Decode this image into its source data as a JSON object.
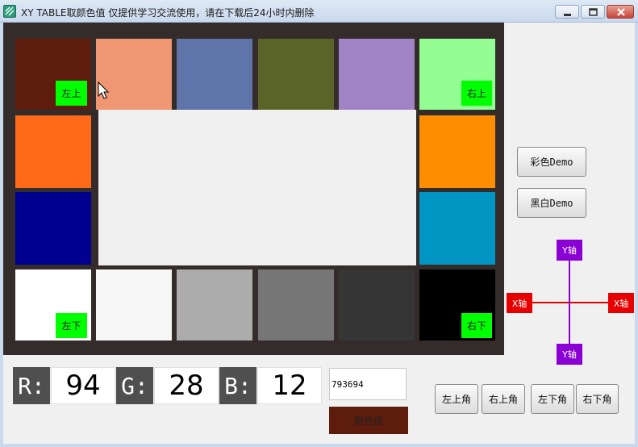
{
  "window": {
    "title": "XY TABLE取颜色值  仅提供学习交流使用，请在下载后24小时内删除",
    "icon": "app-icon",
    "controls": [
      "minimize-icon",
      "maximize-icon",
      "close-icon"
    ]
  },
  "board": {
    "background": "#332c2a",
    "swatches": [
      {
        "id": "r1c1",
        "color": "#5e1c0c"
      },
      {
        "id": "r1c2",
        "color": "#ef9673"
      },
      {
        "id": "r1c3",
        "color": "#5f74a9"
      },
      {
        "id": "r1c4",
        "color": "#5b6428"
      },
      {
        "id": "r1c5",
        "color": "#a083c4"
      },
      {
        "id": "r1c6",
        "color": "#93fd93"
      },
      {
        "id": "r2c1",
        "color": "#ff6a18"
      },
      {
        "id": "r2c6",
        "color": "#ff8d00"
      },
      {
        "id": "r3c1",
        "color": "#00008f"
      },
      {
        "id": "r3c6",
        "color": "#0095c2"
      },
      {
        "id": "r4c1",
        "color": "#ffffff"
      },
      {
        "id": "r4c2",
        "color": "#f7f7f7"
      },
      {
        "id": "r4c3",
        "color": "#acacac"
      },
      {
        "id": "r4c4",
        "color": "#767676"
      },
      {
        "id": "r4c5",
        "color": "#363636"
      },
      {
        "id": "r4c6",
        "color": "#000000"
      }
    ],
    "corner_tags": {
      "top_left": "左上",
      "top_right": "右上",
      "bottom_left": "左下",
      "bottom_right": "右下"
    },
    "tag_color": "#00ff00"
  },
  "side_buttons": {
    "color_demo": "彩色Demo",
    "bw_demo": "黑白Demo"
  },
  "axes": {
    "x_left": "X轴",
    "x_right": "X轴",
    "y_top": "Y轴",
    "y_bottom": "Y轴",
    "x_color": "#e60000",
    "y_color": "#8a00d4"
  },
  "readout": {
    "r_label": "R:",
    "r_value": "94",
    "g_label": "G:",
    "g_value": "28",
    "b_label": "B:",
    "b_value": "12",
    "hex": "793694",
    "color_value_label": "颜色值",
    "color_value_swatch": "#5e1c0c"
  },
  "corner_buttons": {
    "top_left": "左上角",
    "top_right": "右上角",
    "bottom_left": "左下角",
    "bottom_right": "右下角"
  }
}
